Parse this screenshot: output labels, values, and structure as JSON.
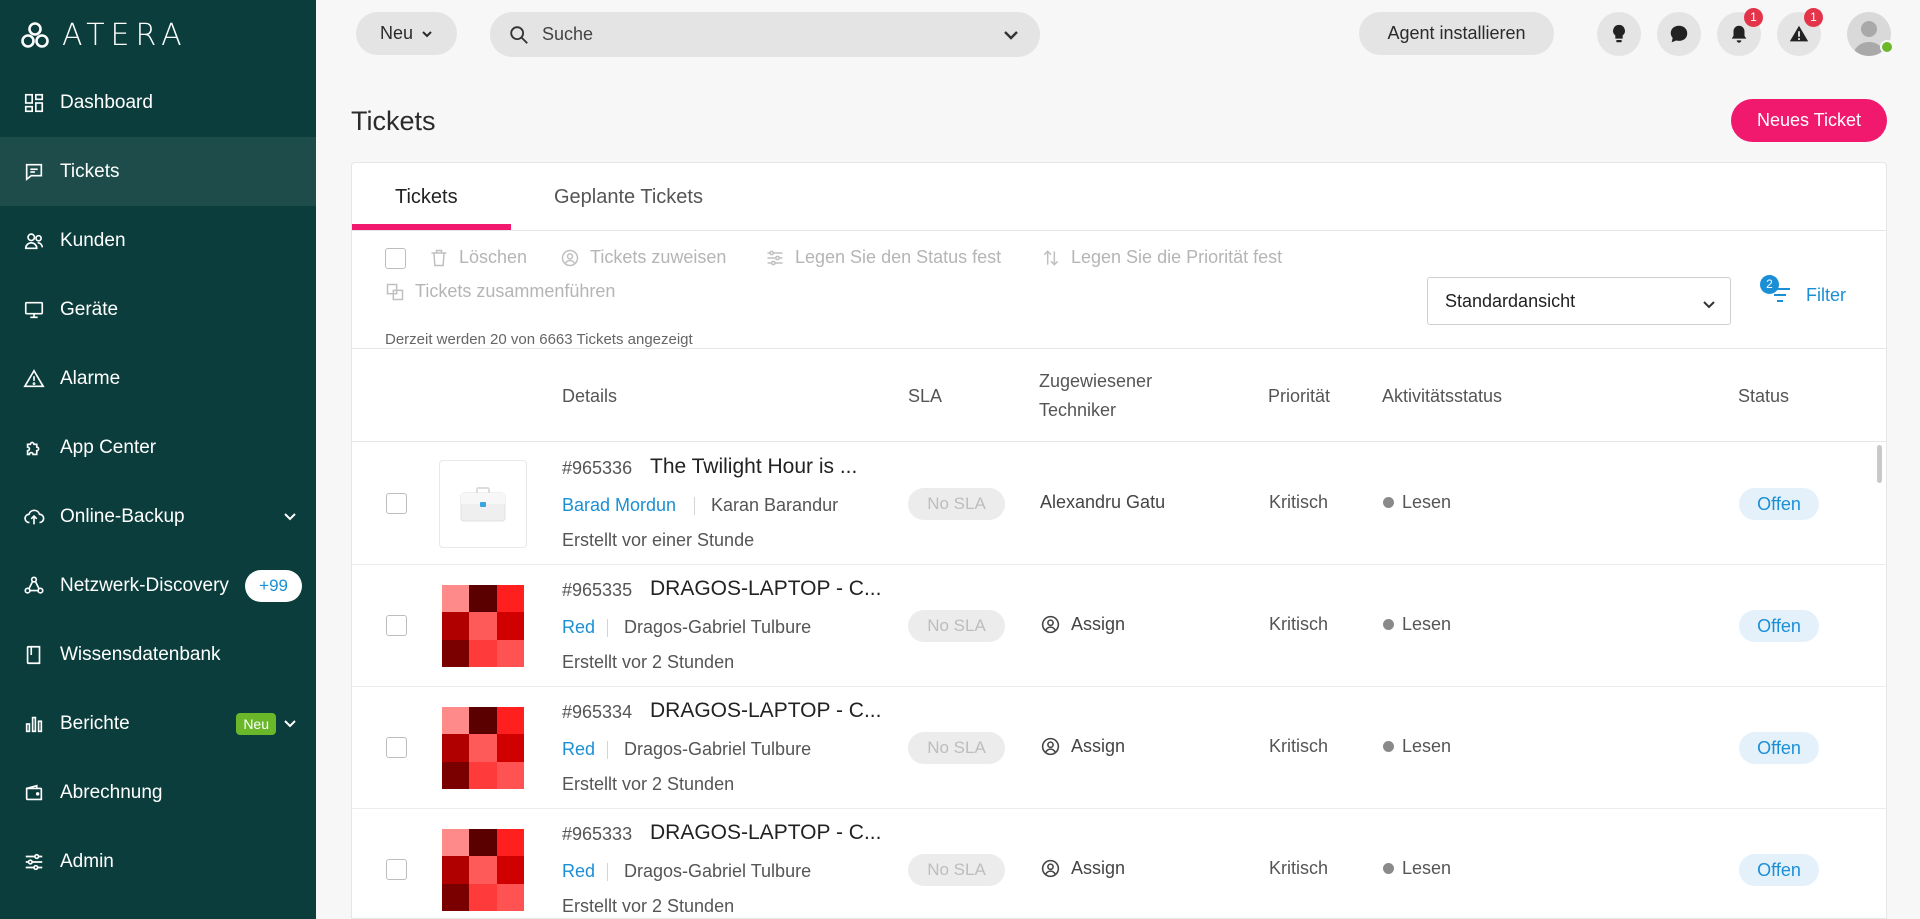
{
  "app": {
    "logo_text": "ATERA"
  },
  "sidebar": {
    "items": [
      {
        "label": "Dashboard",
        "icon": "dashboard-icon"
      },
      {
        "label": "Tickets",
        "icon": "ticket-icon",
        "active": true
      },
      {
        "label": "Kunden",
        "icon": "customers-icon"
      },
      {
        "label": "Geräte",
        "icon": "monitor-icon"
      },
      {
        "label": "Alarme",
        "icon": "alert-icon"
      },
      {
        "label": "App Center",
        "icon": "puzzle-icon"
      },
      {
        "label": "Online-Backup",
        "icon": "cloud-upload-icon",
        "expandable": true
      },
      {
        "label": "Netzwerk-Discovery",
        "icon": "network-icon",
        "badge": "+99"
      },
      {
        "label": "Wissensdatenbank",
        "icon": "book-icon"
      },
      {
        "label": "Berichte",
        "icon": "bar-chart-icon",
        "badge": "Neu",
        "expandable": true
      },
      {
        "label": "Abrechnung",
        "icon": "wallet-icon"
      },
      {
        "label": "Admin",
        "icon": "sliders-icon"
      }
    ]
  },
  "header": {
    "new_label": "Neu",
    "search_placeholder": "Suche",
    "agent_label": "Agent installieren",
    "notifications_count": "1",
    "alerts_count": "1"
  },
  "page": {
    "title": "Tickets",
    "new_ticket_label": "Neues Ticket"
  },
  "tabs": [
    {
      "label": "Tickets",
      "active": true
    },
    {
      "label": "Geplante Tickets"
    }
  ],
  "toolbar": {
    "delete_label": "Löschen",
    "assign_label": "Tickets zuweisen",
    "status_label": "Legen Sie den Status fest",
    "priority_label": "Legen Sie die Priorität fest",
    "merge_label": "Tickets zusammenführen",
    "count_text": "Derzeit werden 20 von 6663 Tickets angezeigt",
    "view_selected": "Standardansicht",
    "filter_label": "Filter",
    "filter_count": "2"
  },
  "table": {
    "columns": {
      "details": "Details",
      "sla": "SLA",
      "tech_line1": "Zugewiesener",
      "tech_line2": "Techniker",
      "priority": "Priorität",
      "activity": "Aktivitätsstatus",
      "status": "Status"
    },
    "rows": [
      {
        "id": "#965336",
        "title": "The Twilight Hour is ...",
        "customer": "Barad Mordun",
        "contact": "Karan Barandur",
        "created": "Erstellt vor einer Stunde",
        "sla": "No SLA",
        "technician": "Alexandru Gatu",
        "priority": "Kritisch",
        "activity": "Lesen",
        "status": "Offen"
      },
      {
        "id": "#965335",
        "title": "DRAGOS-LAPTOP - C...",
        "customer": "Red",
        "contact": "Dragos-Gabriel Tulbure",
        "created": "Erstellt vor 2 Stunden",
        "sla": "No SLA",
        "technician": "Assign",
        "priority": "Kritisch",
        "activity": "Lesen",
        "status": "Offen"
      },
      {
        "id": "#965334",
        "title": "DRAGOS-LAPTOP - C...",
        "customer": "Red",
        "contact": "Dragos-Gabriel Tulbure",
        "created": "Erstellt vor 2 Stunden",
        "sla": "No SLA",
        "technician": "Assign",
        "priority": "Kritisch",
        "activity": "Lesen",
        "status": "Offen"
      },
      {
        "id": "#965333",
        "title": "DRAGOS-LAPTOP - C...",
        "customer": "Red",
        "contact": "Dragos-Gabriel Tulbure",
        "created": "Erstellt vor 2 Stunden",
        "sla": "No SLA",
        "technician": "Assign",
        "priority": "Kritisch",
        "activity": "Lesen",
        "status": "Offen"
      }
    ]
  },
  "colors": {
    "sidebar_bg": "#0b3d3c",
    "sidebar_active": "#1d4c4b",
    "accent_pink": "#f1196e",
    "link_blue": "#1a8fd6",
    "badge_green": "#6ab82a",
    "notif_red": "#e3344a"
  }
}
